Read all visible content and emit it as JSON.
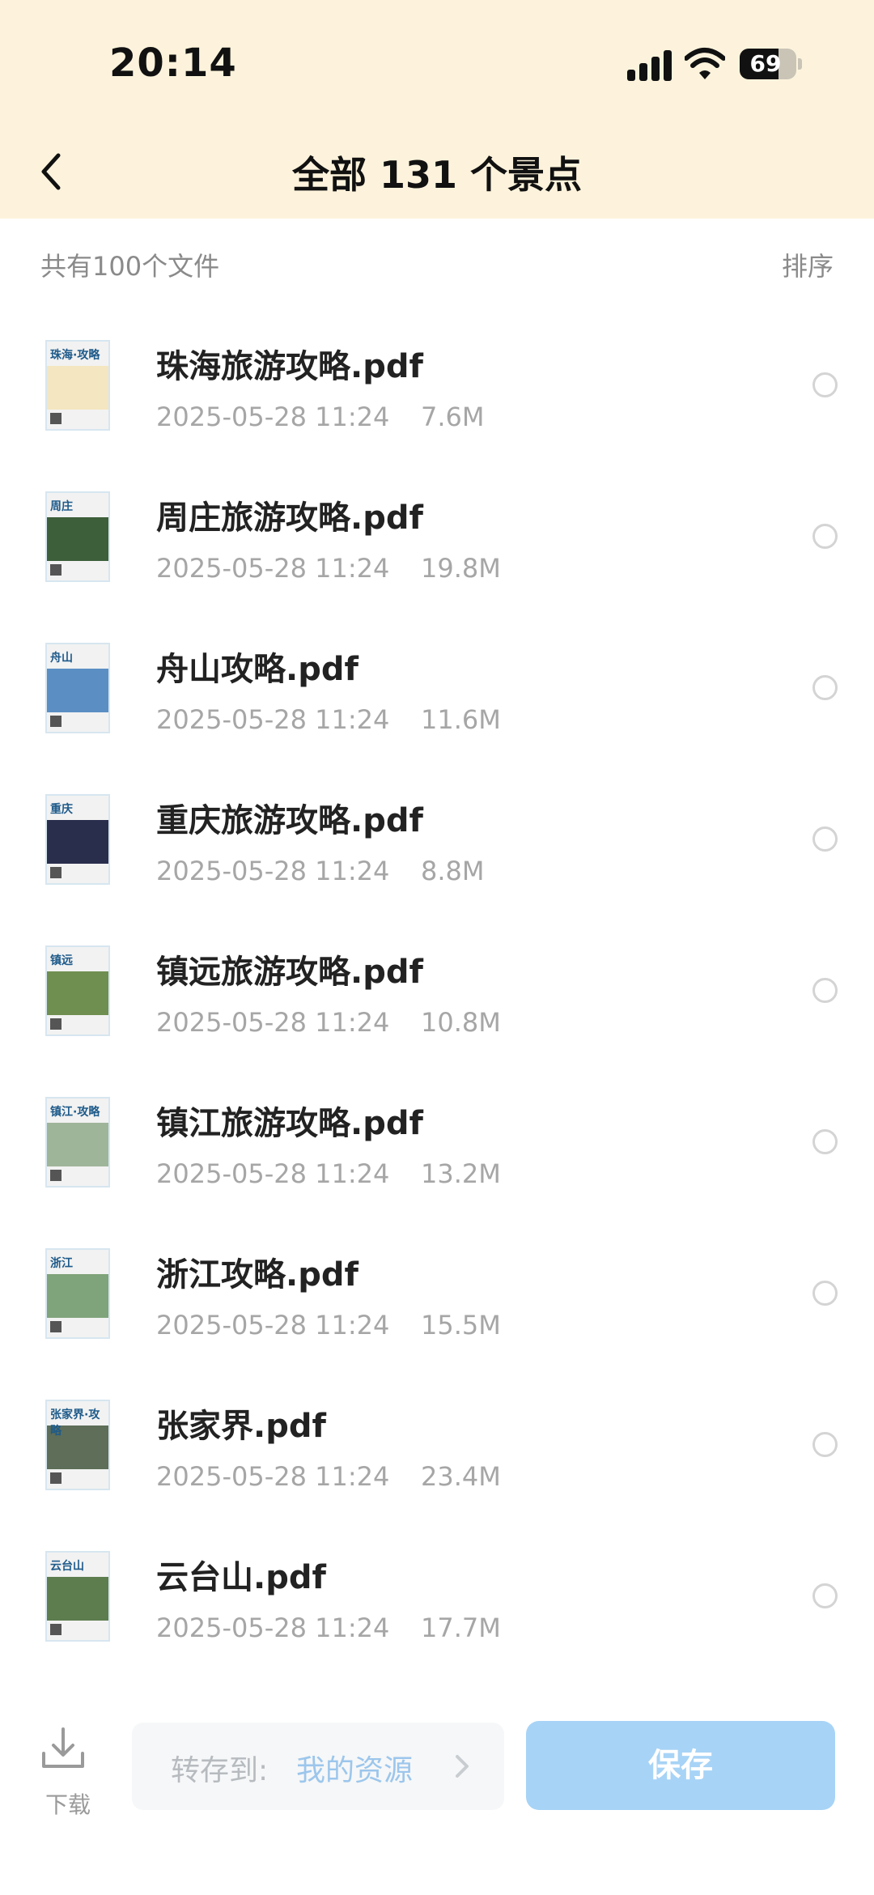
{
  "status_bar": {
    "time": "20:14",
    "battery_percent": "69",
    "battery_level": 0.69
  },
  "header": {
    "title": "全部 131 个景点"
  },
  "subheader": {
    "file_count": "共有100个文件",
    "sort_label": "排序"
  },
  "thumb_icon": "pdf-cover-thumbnail",
  "files": [
    {
      "name": "珠海旅游攻略.pdf",
      "date": "2025-05-28 11:24",
      "size": "7.6M",
      "cover_text": "珠海·攻略",
      "cover_color": "#f4e6c0"
    },
    {
      "name": "周庄旅游攻略.pdf",
      "date": "2025-05-28 11:24",
      "size": "19.8M",
      "cover_text": "周庄",
      "cover_color": "#3d5f3a"
    },
    {
      "name": "舟山攻略.pdf",
      "date": "2025-05-28 11:24",
      "size": "11.6M",
      "cover_text": "舟山",
      "cover_color": "#5b8fc4"
    },
    {
      "name": "重庆旅游攻略.pdf",
      "date": "2025-05-28 11:24",
      "size": "8.8M",
      "cover_text": "重庆",
      "cover_color": "#2a2e4d"
    },
    {
      "name": "镇远旅游攻略.pdf",
      "date": "2025-05-28 11:24",
      "size": "10.8M",
      "cover_text": "镇远",
      "cover_color": "#6f8f50"
    },
    {
      "name": "镇江旅游攻略.pdf",
      "date": "2025-05-28 11:24",
      "size": "13.2M",
      "cover_text": "镇江·攻略",
      "cover_color": "#9fb59a"
    },
    {
      "name": "浙江攻略.pdf",
      "date": "2025-05-28 11:24",
      "size": "15.5M",
      "cover_text": "浙江",
      "cover_color": "#7fa37a"
    },
    {
      "name": "张家界.pdf",
      "date": "2025-05-28 11:24",
      "size": "23.4M",
      "cover_text": "张家界·攻略",
      "cover_color": "#5e6e58"
    },
    {
      "name": "云台山.pdf",
      "date": "2025-05-28 11:24",
      "size": "17.7M",
      "cover_text": "云台山",
      "cover_color": "#5d7d4e"
    }
  ],
  "bottom_bar": {
    "download_label": "下载",
    "transfer_label": "转存到:",
    "transfer_target": "我的资源",
    "save_label": "保存"
  },
  "colors": {
    "header_bg": "#fdf3dc",
    "accent": "#a7d3f6",
    "link": "#9cc6ec"
  }
}
